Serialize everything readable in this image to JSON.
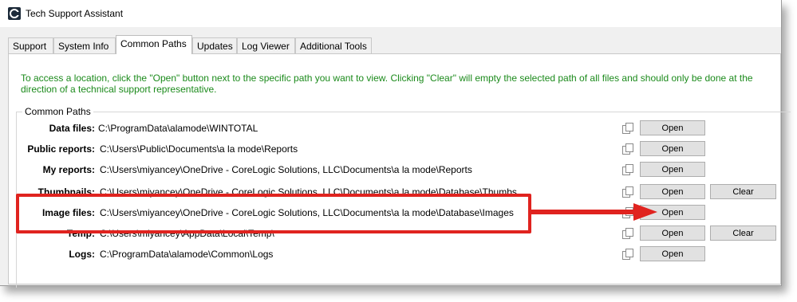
{
  "window": {
    "title": "Tech Support Assistant"
  },
  "tabs": [
    {
      "label": "Support"
    },
    {
      "label": "System Info"
    },
    {
      "label": "Common Paths"
    },
    {
      "label": "Updates"
    },
    {
      "label": "Log Viewer"
    },
    {
      "label": "Additional Tools"
    }
  ],
  "active_tab": "Common Paths",
  "instructions": "To access a location, click the \"Open\" button next to the specific path you want to view.  Clicking \"Clear\" will empty the selected path of all files and should only be done at the direction of a technical support representative.",
  "group_title": "Common Paths",
  "rows": [
    {
      "label": "Data files:",
      "path": "C:\\ProgramData\\alamode\\WINTOTAL",
      "open": "Open"
    },
    {
      "label": "Public reports:",
      "path": "C:\\Users\\Public\\Documents\\a la mode\\Reports",
      "open": "Open"
    },
    {
      "label": "My reports:",
      "path": "C:\\Users\\miyancey\\OneDrive - CoreLogic Solutions, LLC\\Documents\\a la mode\\Reports",
      "open": "Open"
    },
    {
      "label": "Thumbnails:",
      "path": "C:\\Users\\miyancey\\OneDrive - CoreLogic Solutions, LLC\\Documents\\a la mode\\Database\\Thumbs",
      "open": "Open",
      "clear": "Clear"
    },
    {
      "label": "Image files:",
      "path": "C:\\Users\\miyancey\\OneDrive - CoreLogic Solutions, LLC\\Documents\\a la mode\\Database\\Images",
      "open": "Open"
    },
    {
      "label": "Temp:",
      "path": "C:\\Users\\miyancey\\AppData\\Local\\Temp\\",
      "open": "Open",
      "clear": "Clear"
    },
    {
      "label": "Logs:",
      "path": "C:\\ProgramData\\alamode\\Common\\Logs",
      "open": "Open"
    }
  ],
  "colors": {
    "instructions": "#1b8a1b",
    "highlight": "#e0231f"
  },
  "icons": {
    "app": "app-logo-icon",
    "copy": "copy-icon"
  }
}
